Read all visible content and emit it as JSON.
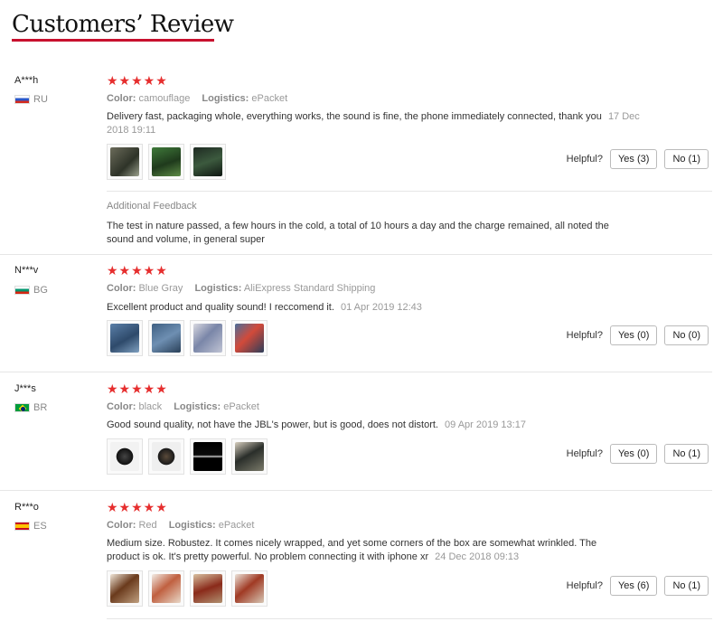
{
  "page": {
    "title": "Customers’ Review"
  },
  "labels": {
    "color": "Color:",
    "logistics": "Logistics:",
    "helpful": "Helpful?",
    "additional_feedback": "Additional Feedback"
  },
  "colors": {
    "accent": "#c8102e",
    "stars": "#e62e2e"
  },
  "reviews": [
    {
      "user": "A***h",
      "country": "RU",
      "stars": "★★★★★",
      "rating": 5,
      "color": "camouflage",
      "logistics": "ePacket",
      "text": "Delivery fast, packaging whole, everything works, the sound is fine, the phone immediately connected, thank you",
      "date": "17 Dec 2018 19:11",
      "yes": "Yes (3)",
      "no": "No (1)",
      "thumb_count": 3,
      "additional_feedback": "The test in nature passed, a few hours in the cold, a total of 10 hours a day and the charge remained, all noted the sound and volume, in general super"
    },
    {
      "user": "N***v",
      "country": "BG",
      "stars": "★★★★★",
      "rating": 5,
      "color": "Blue Gray",
      "logistics": "AliExpress Standard Shipping",
      "text": "Excellent product and quality sound! I reccomend it.",
      "date": "01 Apr 2019 12:43",
      "yes": "Yes (0)",
      "no": "No (0)",
      "thumb_count": 4
    },
    {
      "user": "J***s",
      "country": "BR",
      "stars": "★★★★★",
      "rating": 5,
      "color": "black",
      "logistics": "ePacket",
      "text": "Good sound quality, not have the JBL's power, but is good, does not distort.",
      "date": "09 Apr 2019 13:17",
      "yes": "Yes (0)",
      "no": "No (1)",
      "thumb_count": 4
    },
    {
      "user": "R***o",
      "country": "ES",
      "stars": "★★★★★",
      "rating": 5,
      "color": "Red",
      "logistics": "ePacket",
      "text": "Medium size. Robustez. It comes nicely wrapped, and yet some corners of the box are somewhat wrinkled. The product is ok. It's pretty powerful. No problem connecting it with iphone xr",
      "date": "24 Dec 2018 09:13",
      "yes": "Yes (6)",
      "no": "No (1)",
      "thumb_count": 4
    }
  ]
}
